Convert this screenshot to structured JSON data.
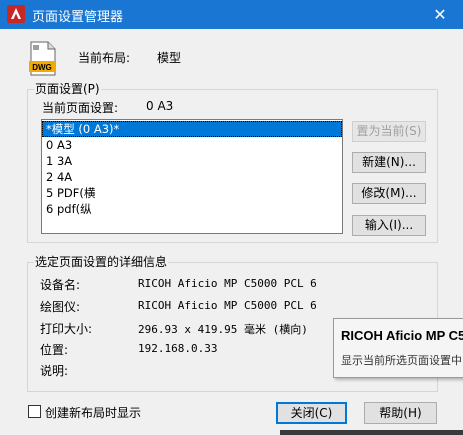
{
  "window": {
    "title": "页面设置管理器",
    "close_glyph": "✕",
    "accent": "#1976d2"
  },
  "layout": {
    "label": "当前布局:",
    "value": "模型",
    "icon_text": "DWG"
  },
  "page_setups": {
    "group_label": "页面设置(P)",
    "current_label": "当前页面设置:",
    "current_value": "0  A3",
    "items": [
      {
        "label": "*模型 (0  A3)*",
        "selected": true
      },
      {
        "label": "0  A3"
      },
      {
        "label": "1  3A"
      },
      {
        "label": "2  4A"
      },
      {
        "label": "5   PDF(横"
      },
      {
        "label": "6  pdf(纵"
      }
    ]
  },
  "buttons": {
    "set_current": "置为当前(S)",
    "new": "新建(N)...",
    "modify": "修改(M)...",
    "import": "输入(I)...",
    "close": "关闭(C)",
    "help": "帮助(H)"
  },
  "details": {
    "group_label": "选定页面设置的详细信息",
    "device_label": "设备名:",
    "device_value": "RICOH Aficio MP C5000 PCL 6",
    "plotter_label": "绘图仪:",
    "plotter_value": "RICOH Aficio MP C5000 PCL 6",
    "size_label": "打印大小:",
    "size_value": "296.93 x 419.95 毫米 (横向)",
    "location_label": "位置:",
    "location_value": "192.168.0.33",
    "description_label": "说明:"
  },
  "tooltip": {
    "title": "RICOH Aficio MP C5",
    "description": "显示当前所选页面设置中"
  },
  "footer": {
    "checkbox_label": "创建新布局时显示",
    "checkbox_checked": false
  }
}
